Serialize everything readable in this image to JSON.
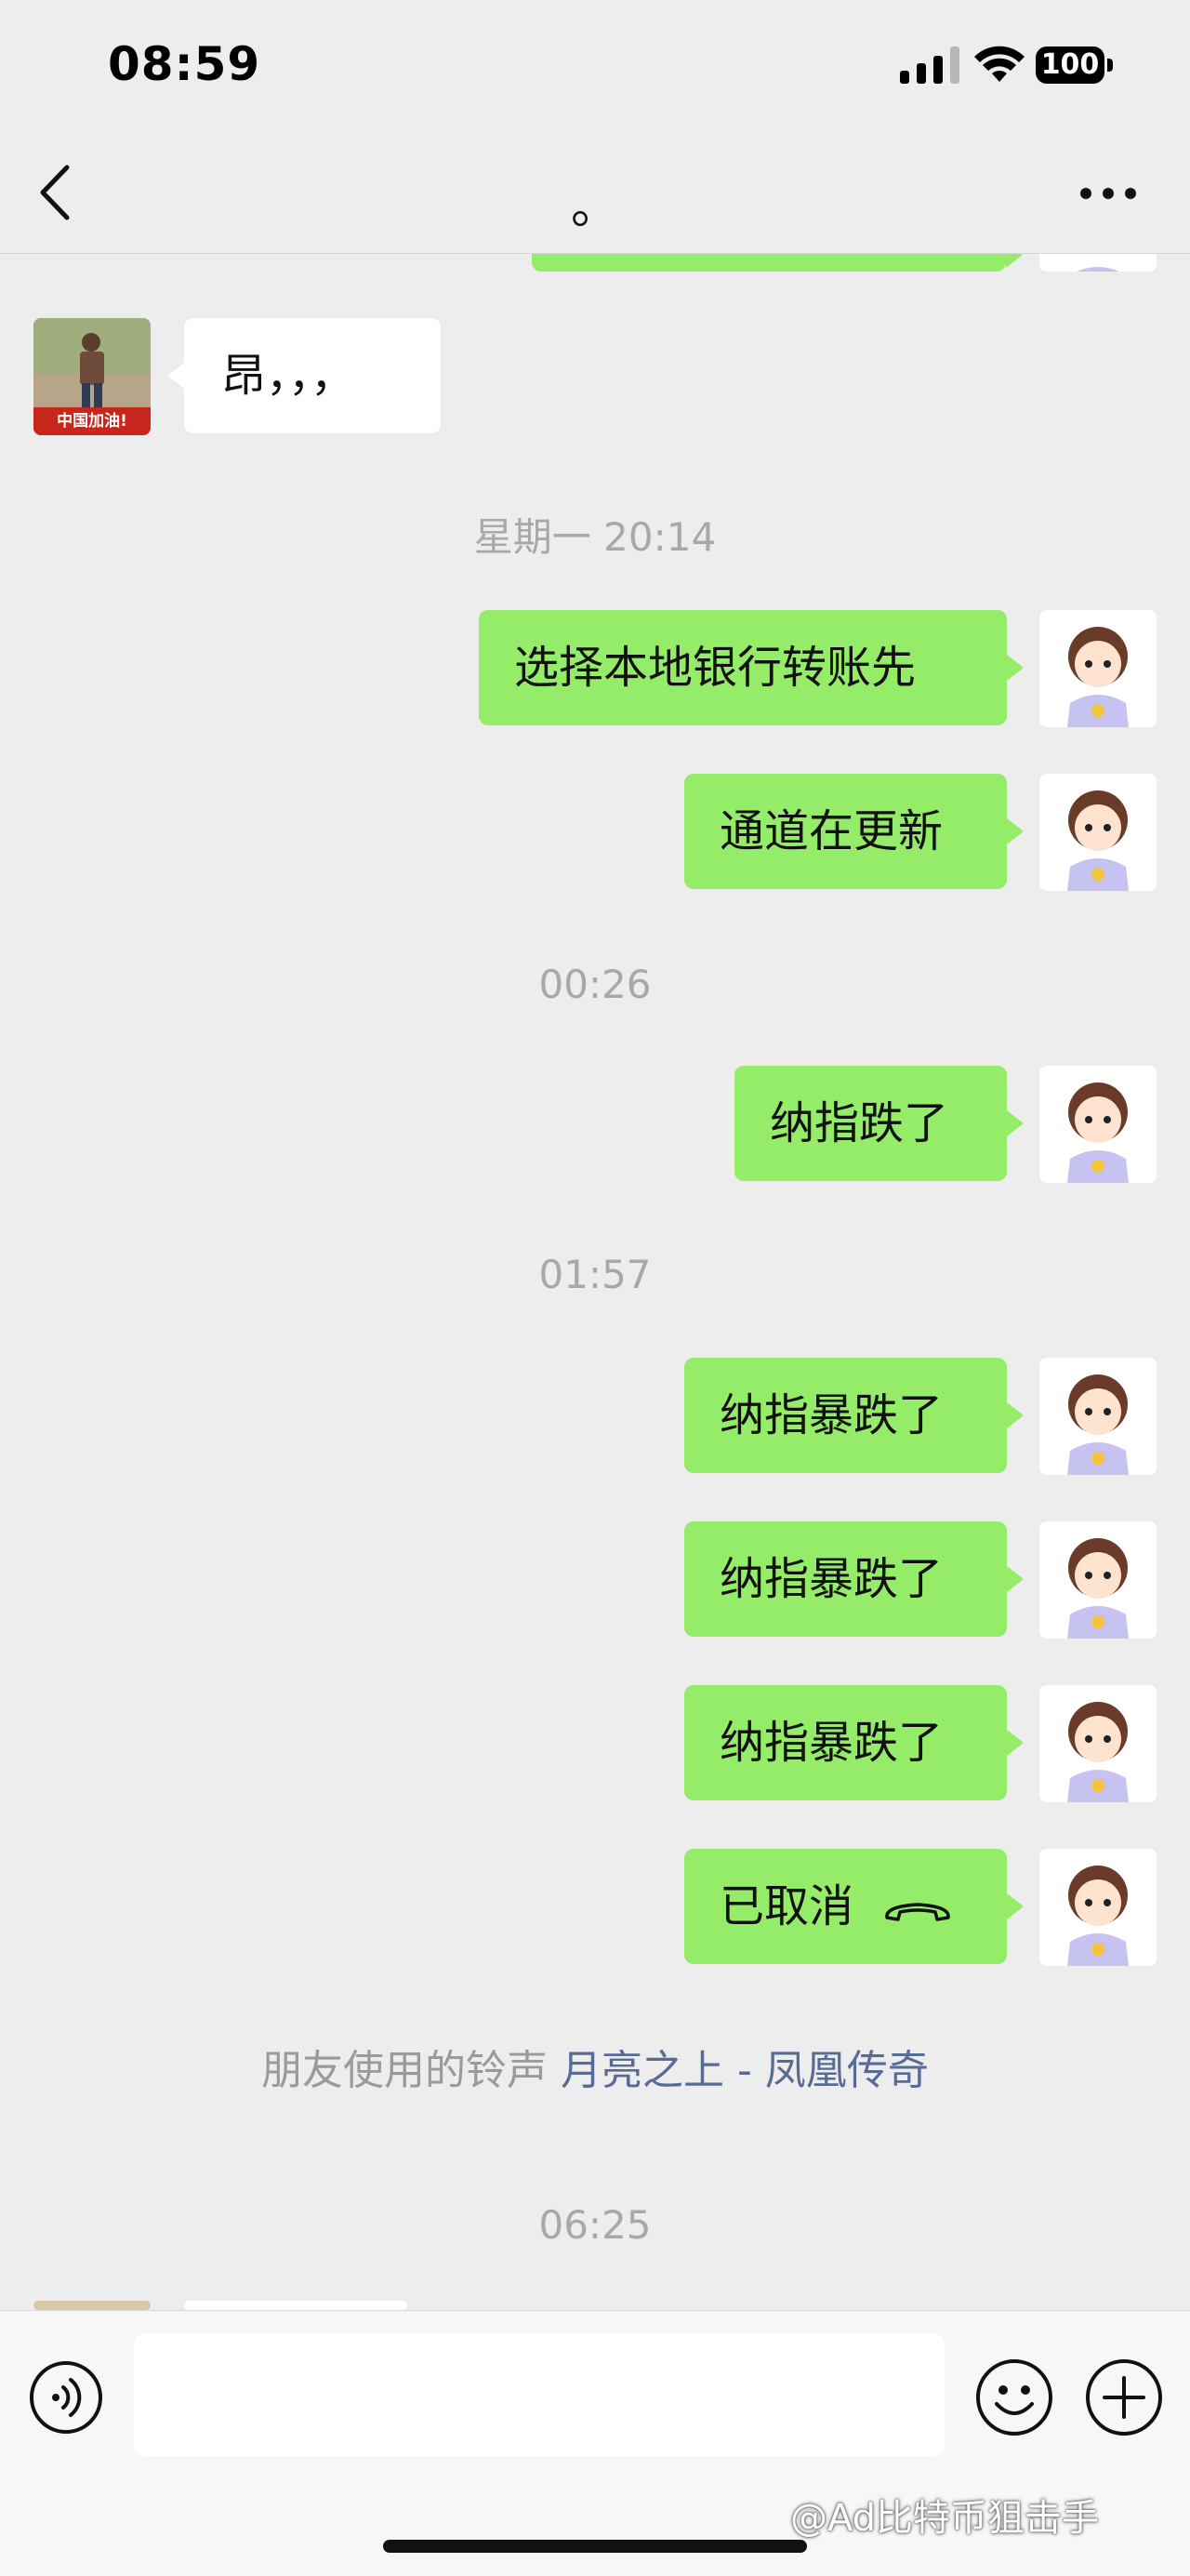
{
  "status_bar": {
    "time": "08:59",
    "battery": "100"
  },
  "nav": {
    "title": "。"
  },
  "messages": {
    "m1": "昂，，，",
    "t1": "星期一 20:14",
    "m2": "选择本地银行转账先",
    "m3": "通道在更新",
    "t2": "00:26",
    "m4": "纳指跌了",
    "t3": "01:57",
    "m5": "纳指暴跌了",
    "m6": "纳指暴跌了",
    "m7": "纳指暴跌了",
    "m8": "已取消",
    "ringtone_prefix": "朋友使用的铃声",
    "ringtone_song": "月亮之上 - 凤凰传奇",
    "t4": "06:25"
  },
  "contact_avatar_badge": "中国加油!",
  "toolbar": {
    "input_value": ""
  },
  "watermark": "@Ad比特币狙击手",
  "colors": {
    "my_bubble": "#95ec69",
    "other_bubble": "#ffffff",
    "background": "#ededed",
    "link": "#576b95"
  },
  "icons": [
    "back-icon",
    "more-icon",
    "voice-icon",
    "emoji-icon",
    "plus-icon",
    "call-ended-icon",
    "wifi-icon",
    "signal-icon"
  ]
}
